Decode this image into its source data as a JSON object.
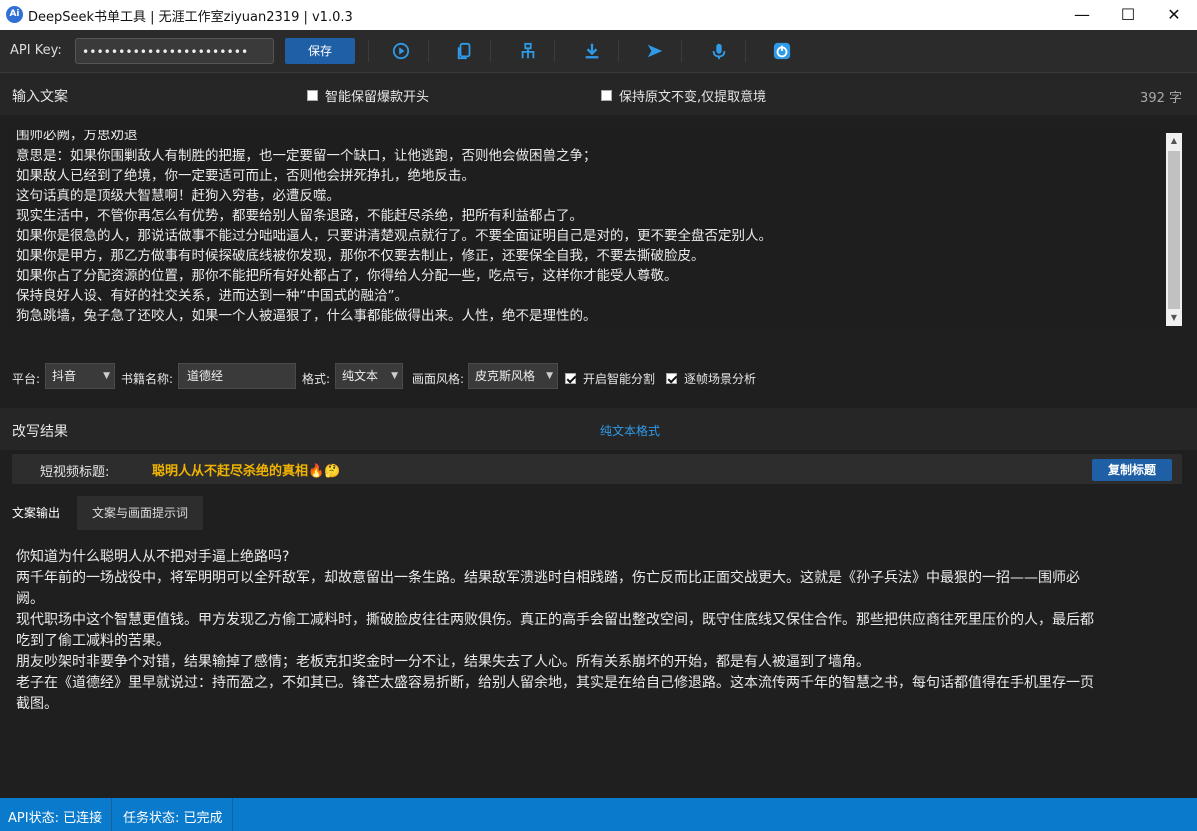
{
  "window": {
    "title": "DeepSeek书单工具 | 无涯工作室ziyuan2319 | v1.0.3",
    "app_icon_text": "Ai"
  },
  "toolbar": {
    "api_key_label": "API Key:",
    "api_key_value": "•••••••••••••••••••••••",
    "save_label": "保存",
    "icons": [
      "play-circle-icon",
      "copy-icon",
      "tree-icon",
      "download-icon",
      "send-icon",
      "microphone-icon",
      "power-icon"
    ],
    "accent_color": "#2f9be8"
  },
  "input_section": {
    "title": "输入文案",
    "option1": "智能保留爆款开头",
    "option2": "保持原文不变,仅提取意境",
    "char_count": "392 字",
    "lines": [
      "围师必阙，方思劝退",
      "意思是：如果你围剿敌人有制胜的把握，也一定要留一个缺口，让他逃跑，否则他会做困兽之争；",
      "如果敌人已经到了绝境，你一定要适可而止，否则他会拼死挣扎，绝地反击。",
      "这句话真的是顶级大智慧啊！赶狗入穷巷，必遭反噬。",
      "现实生活中，不管你再怎么有优势，都要给别人留条退路，不能赶尽杀绝，把所有利益都占了。",
      "如果你是很急的人，那说话做事不能过分咄咄逼人，只要讲清楚观点就行了。不要全面证明自己是对的，更不要全盘否定别人。",
      "如果你是甲方，那乙方做事有时候探破底线被你发现，那你不仅要去制止，修正，还要保全自我，不要去撕破脸皮。",
      "如果你占了分配资源的位置，那你不能把所有好处都占了，你得给人分配一些，吃点亏，这样你才能受人尊敬。",
      "保持良好人设、有好的社交关系，进而达到一种“中国式的融洽”。",
      "狗急跳墙，兔子急了还咬人，如果一个人被逼狠了，什么事都能做得出来。人性，绝不是理性的。"
    ]
  },
  "options": {
    "platform_label": "平台:",
    "platform_value": "抖音",
    "book_label": "书籍名称:",
    "book_value": "道德经",
    "format_label": "格式:",
    "format_value": "纯文本",
    "style_label": "画面风格:",
    "style_value": "皮克斯风格",
    "smart_split_label": "开启智能分割",
    "scene_analysis_label": "逐帧场景分析"
  },
  "result_section": {
    "title": "改写结果",
    "format_note": "纯文本格式",
    "short_title_label": "短视频标题:",
    "short_title_value": "聪明人从不赶尽杀绝的真相🔥🤔",
    "copy_title_label": "复制标题",
    "tabs": [
      "文案输出",
      "文案与画面提示词"
    ],
    "output_lines": [
      "你知道为什么聪明人从不把对手逼上绝路吗?",
      "两千年前的一场战役中，将军明明可以全歼敌军，却故意留出一条生路。结果敌军溃逃时自相践踏，伤亡反而比正面交战更大。这就是《孙子兵法》中最狠的一招——围师必",
      "阙。",
      "现代职场中这个智慧更值钱。甲方发现乙方偷工减料时，撕破脸皮往往两败俱伤。真正的高手会留出整改空间，既守住底线又保住合作。那些把供应商往死里压价的人，最后都",
      "吃到了偷工减料的苦果。",
      "朋友吵架时非要争个对错，结果输掉了感情；老板克扣奖金时一分不让，结果失去了人心。所有关系崩坏的开始，都是有人被逼到了墙角。",
      "老子在《道德经》里早就说过：持而盈之，不如其已。锋芒太盛容易折断，给别人留余地，其实是在给自己修退路。这本流传两千年的智慧之书，每句话都值得在手机里存一页",
      "截图。"
    ],
    "title_color": "#f0b400"
  },
  "status": {
    "api_status": "API状态: 已连接",
    "task_status": "任务状态: 已完成"
  }
}
